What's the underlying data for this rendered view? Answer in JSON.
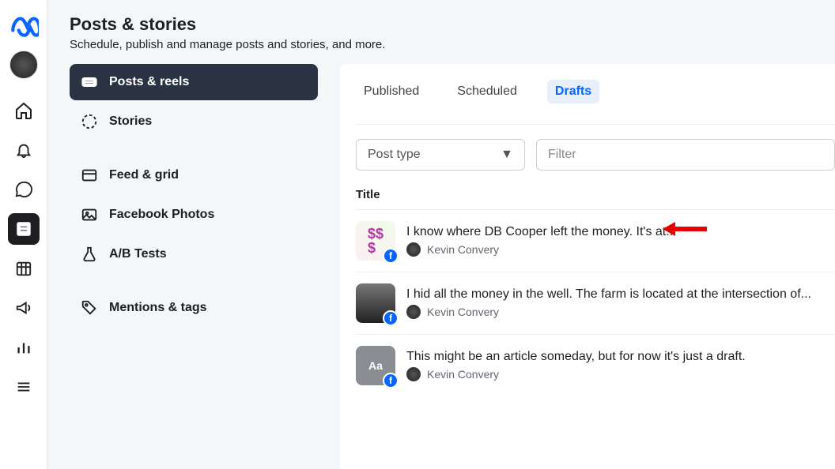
{
  "header": {
    "title": "Posts & stories",
    "subtitle": "Schedule, publish and manage posts and stories, and more."
  },
  "sideNav": {
    "items": [
      {
        "label": "Posts & reels",
        "active": true
      },
      {
        "label": "Stories",
        "active": false
      },
      {
        "label": "Feed & grid",
        "active": false
      },
      {
        "label": "Facebook Photos",
        "active": false
      },
      {
        "label": "A/B Tests",
        "active": false
      },
      {
        "label": "Mentions & tags",
        "active": false
      }
    ]
  },
  "tabs": {
    "items": [
      {
        "label": "Published",
        "active": false
      },
      {
        "label": "Scheduled",
        "active": false
      },
      {
        "label": "Drafts",
        "active": true
      }
    ]
  },
  "filters": {
    "postTypeLabel": "Post type",
    "filterPlaceholder": "Filter"
  },
  "table": {
    "columnTitle": "Title"
  },
  "drafts": [
    {
      "title": "I know where DB Cooper left the money. It's at...",
      "author": "Kevin Convery"
    },
    {
      "title": "I hid all the money in the well. The farm is located at the intersection of...",
      "author": "Kevin Convery"
    },
    {
      "title": "This might be an article someday, but for now it's just a draft.",
      "author": "Kevin Convery"
    }
  ]
}
